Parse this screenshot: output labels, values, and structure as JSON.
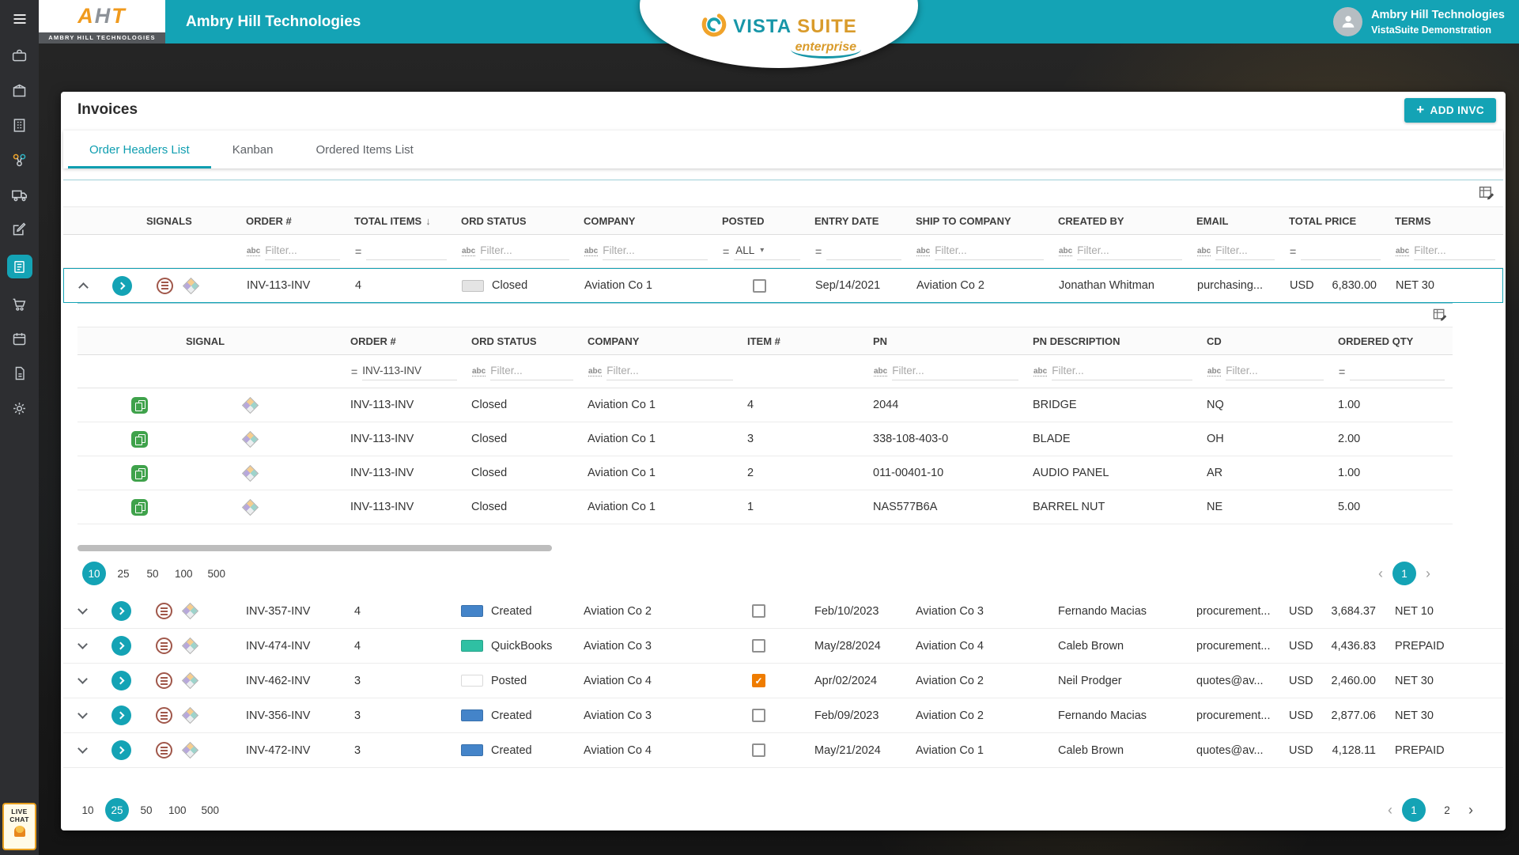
{
  "accent_color": "#14a3b5",
  "icons": {
    "add": "+",
    "sort_desc": "↓",
    "dropdown_caret": "▾",
    "checkmark": "✓",
    "chevron_left": "‹",
    "chevron_right": "›",
    "abc_filter": "abc",
    "equals_filter": "="
  },
  "header": {
    "logo": {
      "letters": [
        "A",
        "H",
        "T"
      ],
      "strip": "AMBRY HILL TECHNOLOGIES"
    },
    "app_title": "Ambry Hill Technologies",
    "brand": {
      "part1": "VISTA",
      "part2": "SUITE",
      "tagline": "enterprise"
    },
    "user": {
      "name": "Ambry Hill Technologies",
      "subtitle": "VistaSuite Demonstration"
    }
  },
  "sidebar": {
    "icon_names": [
      "hamburger-menu",
      "briefcase",
      "package",
      "building",
      "integrations",
      "truck",
      "edit",
      "invoices-active",
      "cart",
      "calendar",
      "document",
      "settings"
    ],
    "live_chat": {
      "line1": "LIVE",
      "line2": "CHAT"
    }
  },
  "page": {
    "title": "Invoices",
    "add_button": "ADD INVC"
  },
  "tabs": [
    {
      "label": "Order Headers List",
      "active": true
    },
    {
      "label": "Kanban",
      "active": false
    },
    {
      "label": "Ordered Items List",
      "active": false
    }
  ],
  "filters": {
    "placeholder": "Filter...",
    "posted_value": "ALL"
  },
  "main_table": {
    "columns": {
      "signals": "SIGNALS",
      "order": "ORDER #",
      "items": "TOTAL ITEMS",
      "status": "ORD STATUS",
      "company": "COMPANY",
      "posted": "POSTED",
      "entry": "ENTRY DATE",
      "ship": "SHIP TO COMPANY",
      "created": "CREATED BY",
      "email": "EMAIL",
      "price": "TOTAL PRICE",
      "terms": "TERMS"
    },
    "rows": [
      {
        "order": "INV-113-INV",
        "items": "4",
        "status": "Closed",
        "status_color": "#e4e4e4",
        "company": "Aviation Co 1",
        "posted": false,
        "entry": "Sep/14/2021",
        "ship": "Aviation Co 2",
        "created": "Jonathan Whitman",
        "email": "purchasing...",
        "currency": "USD",
        "price": "6,830.00",
        "terms": "NET 30",
        "expanded": true
      },
      {
        "order": "INV-357-INV",
        "items": "4",
        "status": "Created",
        "status_color": "#4484c9",
        "company": "Aviation Co 2",
        "posted": false,
        "entry": "Feb/10/2023",
        "ship": "Aviation Co 3",
        "created": "Fernando Macias",
        "email": "procurement...",
        "currency": "USD",
        "price": "3,684.37",
        "terms": "NET 10",
        "expanded": false
      },
      {
        "order": "INV-474-INV",
        "items": "4",
        "status": "QuickBooks",
        "status_color": "#2fc0a3",
        "company": "Aviation Co 3",
        "posted": false,
        "entry": "May/28/2024",
        "ship": "Aviation Co 4",
        "created": "Caleb Brown",
        "email": "procurement...",
        "currency": "USD",
        "price": "4,436.83",
        "terms": "PREPAID",
        "expanded": false
      },
      {
        "order": "INV-462-INV",
        "items": "3",
        "status": "Posted",
        "status_color": "#ffffff",
        "company": "Aviation Co 4",
        "posted": true,
        "entry": "Apr/02/2024",
        "ship": "Aviation Co 2",
        "created": "Neil Prodger",
        "email": "quotes@av...",
        "currency": "USD",
        "price": "2,460.00",
        "terms": "NET 30",
        "expanded": false
      },
      {
        "order": "INV-356-INV",
        "items": "3",
        "status": "Created",
        "status_color": "#4484c9",
        "company": "Aviation Co 3",
        "posted": false,
        "entry": "Feb/09/2023",
        "ship": "Aviation Co 2",
        "created": "Fernando Macias",
        "email": "procurement...",
        "currency": "USD",
        "price": "2,877.06",
        "terms": "NET 30",
        "expanded": false
      },
      {
        "order": "INV-472-INV",
        "items": "3",
        "status": "Created",
        "status_color": "#4484c9",
        "company": "Aviation Co 4",
        "posted": false,
        "entry": "May/21/2024",
        "ship": "Aviation Co 1",
        "created": "Caleb Brown",
        "email": "quotes@av...",
        "currency": "USD",
        "price": "4,128.11",
        "terms": "PREPAID",
        "expanded": false
      }
    ]
  },
  "sub_table": {
    "columns": {
      "signal": "SIGNAL",
      "order": "ORDER #",
      "status": "ORD STATUS",
      "company": "COMPANY",
      "item": "ITEM #",
      "pn": "PN",
      "desc": "PN DESCRIPTION",
      "cd": "CD",
      "qty": "ORDERED QTY"
    },
    "order_filter_value": "INV-113-INV",
    "rows": [
      {
        "order": "INV-113-INV",
        "status": "Closed",
        "company": "Aviation Co 1",
        "item": "4",
        "pn": "2044",
        "desc": "BRIDGE",
        "cd": "NQ",
        "qty": "1.00"
      },
      {
        "order": "INV-113-INV",
        "status": "Closed",
        "company": "Aviation Co 1",
        "item": "3",
        "pn": "338-108-403-0",
        "desc": "BLADE",
        "cd": "OH",
        "qty": "2.00"
      },
      {
        "order": "INV-113-INV",
        "status": "Closed",
        "company": "Aviation Co 1",
        "item": "2",
        "pn": "011-00401-10",
        "desc": "AUDIO PANEL",
        "cd": "AR",
        "qty": "1.00"
      },
      {
        "order": "INV-113-INV",
        "status": "Closed",
        "company": "Aviation Co 1",
        "item": "1",
        "pn": "NAS577B6A",
        "desc": "BARREL NUT",
        "cd": "NE",
        "qty": "5.00"
      }
    ],
    "pagination": {
      "options": [
        {
          "label": "10",
          "selected": true
        },
        {
          "label": "25",
          "selected": false
        },
        {
          "label": "50",
          "selected": false
        },
        {
          "label": "100",
          "selected": false
        },
        {
          "label": "500",
          "selected": false
        }
      ],
      "pages": [
        {
          "label": "1",
          "selected": true
        }
      ]
    }
  },
  "main_pagination": {
    "options": [
      {
        "label": "10",
        "selected": false
      },
      {
        "label": "25",
        "selected": true
      },
      {
        "label": "50",
        "selected": false
      },
      {
        "label": "100",
        "selected": false
      },
      {
        "label": "500",
        "selected": false
      }
    ],
    "pages": [
      {
        "label": "1",
        "selected": true
      },
      {
        "label": "2",
        "selected": false
      }
    ]
  }
}
